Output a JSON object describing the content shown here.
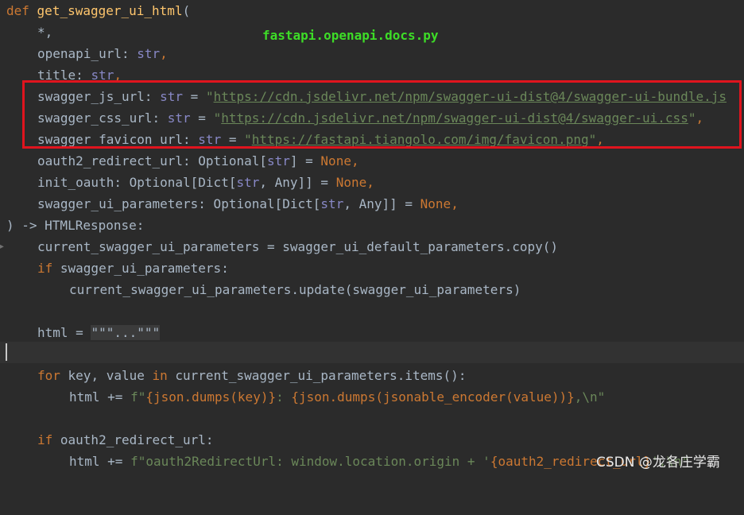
{
  "overlay": {
    "file_label": "fastapi.openapi.docs.py",
    "watermark": "CSDN @龙各庄学霸"
  },
  "code": {
    "l1": {
      "kw": "def",
      "fn": "get_swagger_ui_html",
      "tail": "("
    },
    "l2": {
      "text": "*,"
    },
    "l3": {
      "name": "openapi_url: ",
      "type": "str",
      "tail": ","
    },
    "l4": {
      "name": "title: ",
      "type": "str",
      "tail": ","
    },
    "l5": {
      "name": "swagger_js_url: ",
      "type": "str",
      "eq": " = ",
      "q1": "\"",
      "url": "https://cdn.jsdelivr.net/npm/swagger-ui-dist@4/swagger-ui-bundle.js"
    },
    "l6": {
      "name": "swagger_css_url: ",
      "type": "str",
      "eq": " = ",
      "q1": "\"",
      "url": "https://cdn.jsdelivr.net/npm/swagger-ui-dist@4/swagger-ui.css",
      "q2": "\"",
      "tail": ","
    },
    "l7": {
      "name": "swagger_favicon_url: ",
      "type": "str",
      "eq": " = ",
      "q1": "\"",
      "url": "https://fastapi.tiangolo.com/img/favicon.png",
      "q2": "\"",
      "tail": ","
    },
    "l8": {
      "name": "oauth2_redirect_url: Optional[",
      "type": "str",
      "mid": "] = ",
      "none": "None",
      "tail": ","
    },
    "l9": {
      "name": "init_oauth: Optional[Dict[",
      "type": "str",
      "mid": ", Any]] = ",
      "none": "None",
      "tail": ","
    },
    "l10": {
      "name": "swagger_ui_parameters: Optional[Dict[",
      "type": "str",
      "mid": ", Any]] = ",
      "none": "None",
      "tail": ","
    },
    "l11": {
      "text": ") -> HTMLResponse:"
    },
    "l12": {
      "text": "current_swagger_ui_parameters = swagger_ui_default_parameters.copy()"
    },
    "l13": {
      "kw": "if",
      "text": " swagger_ui_parameters:"
    },
    "l14": {
      "text": "current_swagger_ui_parameters.update(swagger_ui_parameters)"
    },
    "l16": {
      "pre": "html = ",
      "folded": "\"\"\"...\"\"\""
    },
    "l18": {
      "kw1": "for",
      "a": " key, value ",
      "kw2": "in",
      "b": " current_swagger_ui_parameters.items():"
    },
    "l19": {
      "pre": "html += ",
      "f": "f\"",
      "b1": "{json.dumps(key)}",
      "s1": ": ",
      "b2": "{json.dumps(jsonable_encoder(value))}",
      "s2": ",\\n\""
    },
    "l21": {
      "kw": "if",
      "text": " oauth2_redirect_url:"
    },
    "l22": {
      "pre": "html += ",
      "f": "f\"",
      "s1": "oauth2RedirectUrl: window.location.origin + '",
      "b1": "{oauth2_redirect_url}",
      "s2": "',\\n\""
    }
  },
  "colors": {
    "background": "#2b2b2b",
    "keyword": "#cc7832",
    "function": "#ffc66d",
    "builtin": "#8888c6",
    "string": "#6a8759",
    "text": "#a9b7c6",
    "annotation_label": "#3ddc27",
    "highlight_box": "#e0141e"
  }
}
